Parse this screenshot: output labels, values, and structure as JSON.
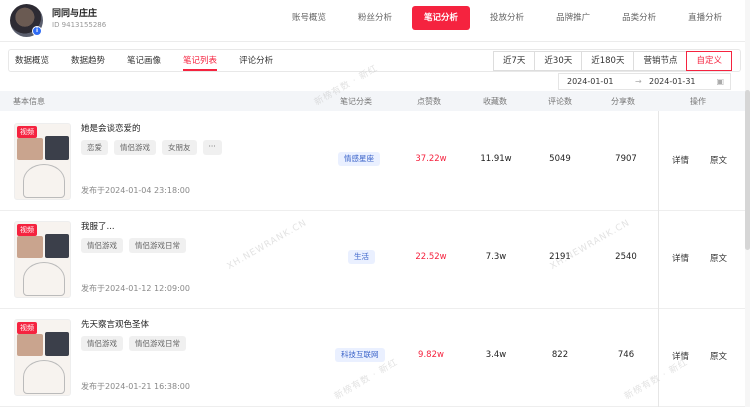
{
  "account": {
    "name": "同同与庄庄",
    "id": "ID 9413155286"
  },
  "main_nav": [
    "账号概览",
    "粉丝分析",
    "笔记分析",
    "投放分析",
    "品牌推广",
    "品类分析",
    "直播分析"
  ],
  "sub_tabs": [
    "数据概览",
    "数据趋势",
    "笔记画像",
    "笔记列表",
    "评论分析"
  ],
  "ranges": [
    "近7天",
    "近30天",
    "近180天",
    "营销节点",
    "自定义"
  ],
  "date_range": {
    "start": "2024-01-01",
    "end": "2024-01-31"
  },
  "table": {
    "headers": [
      "基本信息",
      "笔记分类",
      "点赞数",
      "收藏数",
      "评论数",
      "分享数",
      "操作"
    ],
    "rows": [
      {
        "thumb_tag": "视频",
        "title": "她是会谈恋爱的",
        "tags": [
          "恋爱",
          "情侣游戏",
          "女朋友",
          "···"
        ],
        "category": "情感星座",
        "likes": "37.22w",
        "favorites": "11.91w",
        "comments": "5049",
        "shares": "7907",
        "time": "发布于2024-01-04 23:18:00",
        "op1": "详情",
        "op2": "原文"
      },
      {
        "thumb_tag": "视频",
        "title": "我服了...",
        "tags": [
          "情侣游戏",
          "情侣游戏日常"
        ],
        "category": "生活",
        "likes": "22.52w",
        "favorites": "7.3w",
        "comments": "2191",
        "shares": "2540",
        "time": "发布于2024-01-12 12:09:00",
        "op1": "详情",
        "op2": "原文"
      },
      {
        "thumb_tag": "视频",
        "title": "先天察言观色圣体",
        "tags": [
          "情侣游戏",
          "情侣游戏日常"
        ],
        "category": "科技互联网",
        "likes": "9.82w",
        "favorites": "3.4w",
        "comments": "822",
        "shares": "746",
        "time": "发布于2024-01-21 16:38:00",
        "op1": "详情",
        "op2": "原文"
      }
    ]
  },
  "watermarks": [
    "新榜有数 · 新红",
    "XH.NEWRANK.CN"
  ],
  "colors": {
    "accent": "#f5233f",
    "category_bg": "#eaf0ff",
    "category_text": "#3b63c9"
  }
}
